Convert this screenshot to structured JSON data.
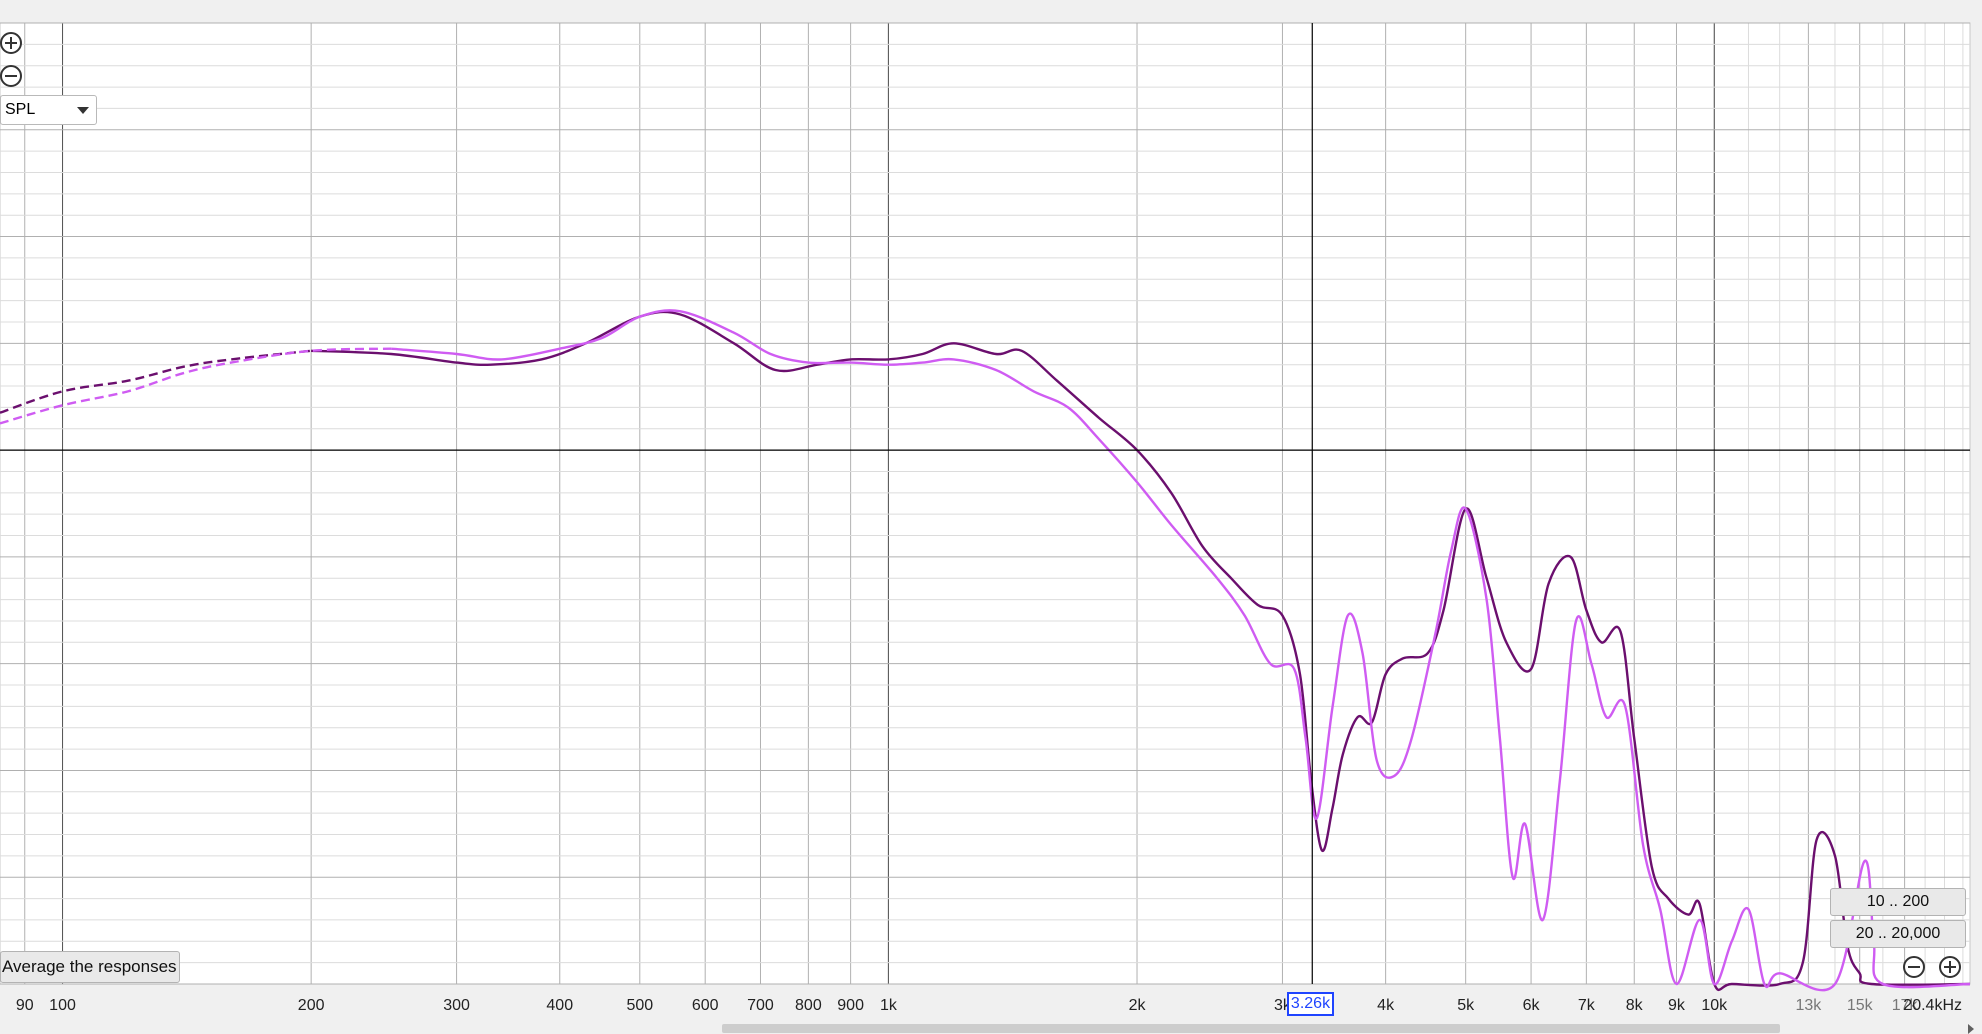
{
  "controls": {
    "measure_select": "SPL",
    "range_buttons": [
      "10 .. 200",
      "20 .. 20,000"
    ],
    "average_button": "Average the responses",
    "cursor_readout": "3.26k"
  },
  "colors": {
    "background": "#ffffff",
    "grid_major": "#b0b0b0",
    "grid_minor": "#dcdcdc",
    "series_dark": "#6b0f6e",
    "series_light": "#cf5cf2",
    "cursor": "#000000"
  },
  "chart_data": {
    "type": "line",
    "x_scale": "log",
    "xlim": [
      84,
      20400
    ],
    "ylim": [
      0,
      9
    ],
    "y_tick_labels": "not shown",
    "grid": true,
    "x_tick_labels": [
      "90",
      "100",
      "200",
      "300",
      "400",
      "500",
      "600",
      "700",
      "800",
      "900",
      "1k",
      "2k",
      "3k",
      "4k",
      "5k",
      "6k",
      "7k",
      "8k",
      "9k",
      "10k",
      "13k",
      "15k",
      "17k",
      "20.4kHz"
    ],
    "x_tick_values": [
      90,
      100,
      200,
      300,
      400,
      500,
      600,
      700,
      800,
      900,
      1000,
      2000,
      3000,
      4000,
      5000,
      6000,
      7000,
      8000,
      9000,
      10000,
      13000,
      15000,
      17000,
      20400
    ],
    "cursor": {
      "x": 3260,
      "y": 5
    },
    "series": [
      {
        "color": "#6b0f6e",
        "dashed_below": 200,
        "points": [
          [
            84,
            5.35
          ],
          [
            100,
            5.55
          ],
          [
            120,
            5.65
          ],
          [
            140,
            5.78
          ],
          [
            160,
            5.85
          ],
          [
            200,
            5.93
          ],
          [
            250,
            5.9
          ],
          [
            300,
            5.82
          ],
          [
            330,
            5.8
          ],
          [
            380,
            5.85
          ],
          [
            430,
            6.0
          ],
          [
            500,
            6.25
          ],
          [
            560,
            6.27
          ],
          [
            650,
            6.0
          ],
          [
            730,
            5.75
          ],
          [
            820,
            5.8
          ],
          [
            900,
            5.85
          ],
          [
            1000,
            5.85
          ],
          [
            1100,
            5.9
          ],
          [
            1200,
            6.0
          ],
          [
            1350,
            5.9
          ],
          [
            1450,
            5.93
          ],
          [
            1600,
            5.65
          ],
          [
            1800,
            5.3
          ],
          [
            2000,
            5.0
          ],
          [
            2200,
            4.6
          ],
          [
            2400,
            4.1
          ],
          [
            2600,
            3.8
          ],
          [
            2800,
            3.55
          ],
          [
            3000,
            3.45
          ],
          [
            3150,
            2.9
          ],
          [
            3250,
            1.9
          ],
          [
            3350,
            1.25
          ],
          [
            3450,
            1.65
          ],
          [
            3550,
            2.15
          ],
          [
            3700,
            2.5
          ],
          [
            3850,
            2.45
          ],
          [
            4000,
            2.9
          ],
          [
            4200,
            3.05
          ],
          [
            4500,
            3.1
          ],
          [
            4700,
            3.5
          ],
          [
            5000,
            4.45
          ],
          [
            5300,
            3.8
          ],
          [
            5600,
            3.2
          ],
          [
            6000,
            2.95
          ],
          [
            6300,
            3.75
          ],
          [
            6700,
            4.0
          ],
          [
            7000,
            3.5
          ],
          [
            7300,
            3.2
          ],
          [
            7700,
            3.3
          ],
          [
            8000,
            2.3
          ],
          [
            8400,
            1.1
          ],
          [
            8800,
            0.8
          ],
          [
            9300,
            0.65
          ],
          [
            9600,
            0.75
          ],
          [
            10000,
            0.0
          ],
          [
            10500,
            0.0
          ],
          [
            12000,
            0.0
          ],
          [
            12800,
            0.2
          ],
          [
            13300,
            1.35
          ],
          [
            14000,
            1.2
          ],
          [
            14500,
            0.35
          ],
          [
            15000,
            0.1
          ],
          [
            15500,
            0.0
          ],
          [
            20400,
            0.0
          ]
        ]
      },
      {
        "color": "#cf5cf2",
        "dashed_below": 250,
        "points": [
          [
            84,
            5.25
          ],
          [
            100,
            5.42
          ],
          [
            120,
            5.55
          ],
          [
            140,
            5.72
          ],
          [
            160,
            5.82
          ],
          [
            200,
            5.93
          ],
          [
            250,
            5.95
          ],
          [
            300,
            5.9
          ],
          [
            340,
            5.85
          ],
          [
            400,
            5.95
          ],
          [
            450,
            6.05
          ],
          [
            500,
            6.25
          ],
          [
            560,
            6.3
          ],
          [
            650,
            6.1
          ],
          [
            720,
            5.9
          ],
          [
            800,
            5.82
          ],
          [
            900,
            5.82
          ],
          [
            1000,
            5.8
          ],
          [
            1100,
            5.82
          ],
          [
            1200,
            5.85
          ],
          [
            1350,
            5.75
          ],
          [
            1500,
            5.55
          ],
          [
            1650,
            5.4
          ],
          [
            1800,
            5.1
          ],
          [
            2000,
            4.7
          ],
          [
            2200,
            4.3
          ],
          [
            2500,
            3.8
          ],
          [
            2700,
            3.45
          ],
          [
            2900,
            3.0
          ],
          [
            3100,
            2.95
          ],
          [
            3200,
            2.3
          ],
          [
            3300,
            1.55
          ],
          [
            3450,
            2.6
          ],
          [
            3600,
            3.45
          ],
          [
            3750,
            3.1
          ],
          [
            3900,
            2.1
          ],
          [
            4100,
            1.95
          ],
          [
            4300,
            2.3
          ],
          [
            4600,
            3.3
          ],
          [
            4800,
            4.05
          ],
          [
            5000,
            4.45
          ],
          [
            5300,
            3.6
          ],
          [
            5500,
            2.3
          ],
          [
            5700,
            1.0
          ],
          [
            5900,
            1.5
          ],
          [
            6200,
            0.6
          ],
          [
            6500,
            1.9
          ],
          [
            6800,
            3.4
          ],
          [
            7100,
            3.0
          ],
          [
            7400,
            2.5
          ],
          [
            7800,
            2.6
          ],
          [
            8200,
            1.3
          ],
          [
            8600,
            0.7
          ],
          [
            9000,
            0.0
          ],
          [
            9600,
            0.6
          ],
          [
            10000,
            0.0
          ],
          [
            10500,
            0.4
          ],
          [
            11000,
            0.7
          ],
          [
            11500,
            0.0
          ],
          [
            12000,
            0.1
          ],
          [
            14000,
            0.0
          ],
          [
            15200,
            1.15
          ],
          [
            15600,
            0.4
          ],
          [
            16000,
            0.0
          ],
          [
            20400,
            0.0
          ]
        ]
      }
    ]
  }
}
